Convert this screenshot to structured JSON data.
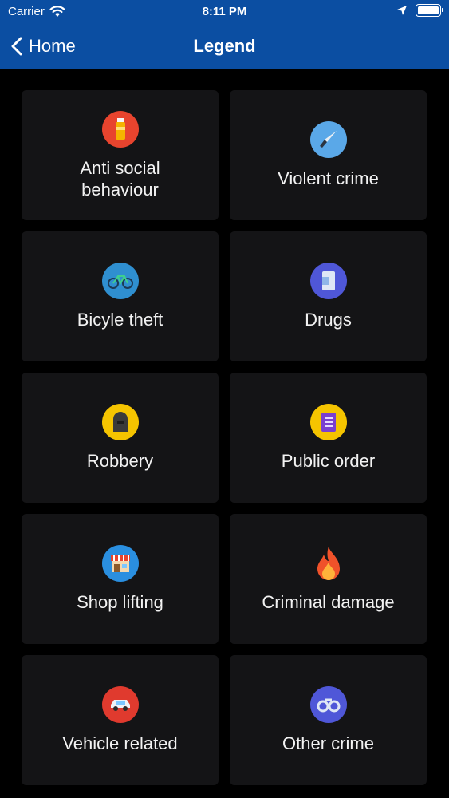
{
  "status_bar": {
    "carrier": "Carrier",
    "time": "8:11 PM"
  },
  "nav": {
    "back_label": "Home",
    "title": "Legend"
  },
  "legend": [
    {
      "label": "Anti social behaviour",
      "icon": "spray-can-icon",
      "color": "#e8442e"
    },
    {
      "label": "Violent crime",
      "icon": "knife-icon",
      "color": "#5aa8e8"
    },
    {
      "label": "Bicyle theft",
      "icon": "bicycle-icon",
      "color": "#2f8fd0"
    },
    {
      "label": "Drugs",
      "icon": "drugs-icon",
      "color": "#4f57d8"
    },
    {
      "label": "Robbery",
      "icon": "tombstone-icon",
      "color": "#f5c400"
    },
    {
      "label": "Public order",
      "icon": "document-icon",
      "color": "#f5c400"
    },
    {
      "label": "Shop lifting",
      "icon": "shop-icon",
      "color": "#2a8fe0"
    },
    {
      "label": "Criminal damage",
      "icon": "fire-icon",
      "color": "transparent"
    },
    {
      "label": "Vehicle related",
      "icon": "car-icon",
      "color": "#e03a2e"
    },
    {
      "label": "Other crime",
      "icon": "handcuffs-icon",
      "color": "#4f57d8"
    }
  ]
}
